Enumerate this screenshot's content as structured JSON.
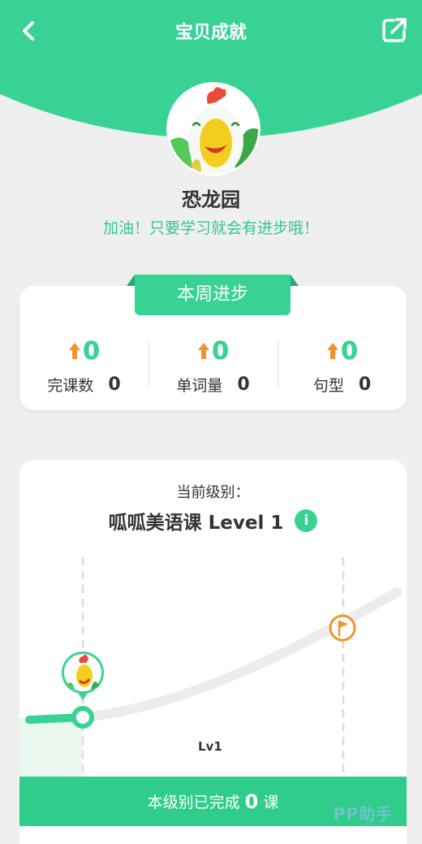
{
  "header": {
    "title": "宝贝成就",
    "back_icon": "chevron-left-icon",
    "share_icon": "share-icon"
  },
  "profile": {
    "name": "恐龙园",
    "motto": "加油！只要学习就会有进步哦！"
  },
  "weekly": {
    "title": "本周进步",
    "stats": [
      {
        "delta": "0",
        "label": "完课数",
        "value": "0"
      },
      {
        "delta": "0",
        "label": "单词量",
        "value": "0"
      },
      {
        "delta": "0",
        "label": "句型",
        "value": "0"
      }
    ]
  },
  "level": {
    "caption": "当前级别：",
    "title": "呱呱美语课 Level 1",
    "info_icon": "i",
    "marker": "Lv1",
    "completed_prefix": "本级别已完成",
    "completed_count": "0",
    "completed_suffix": "课"
  },
  "watermark": "PP助手",
  "colors": {
    "brand": "#38d394",
    "accent_orange": "#f5932a",
    "text": "#333333"
  }
}
